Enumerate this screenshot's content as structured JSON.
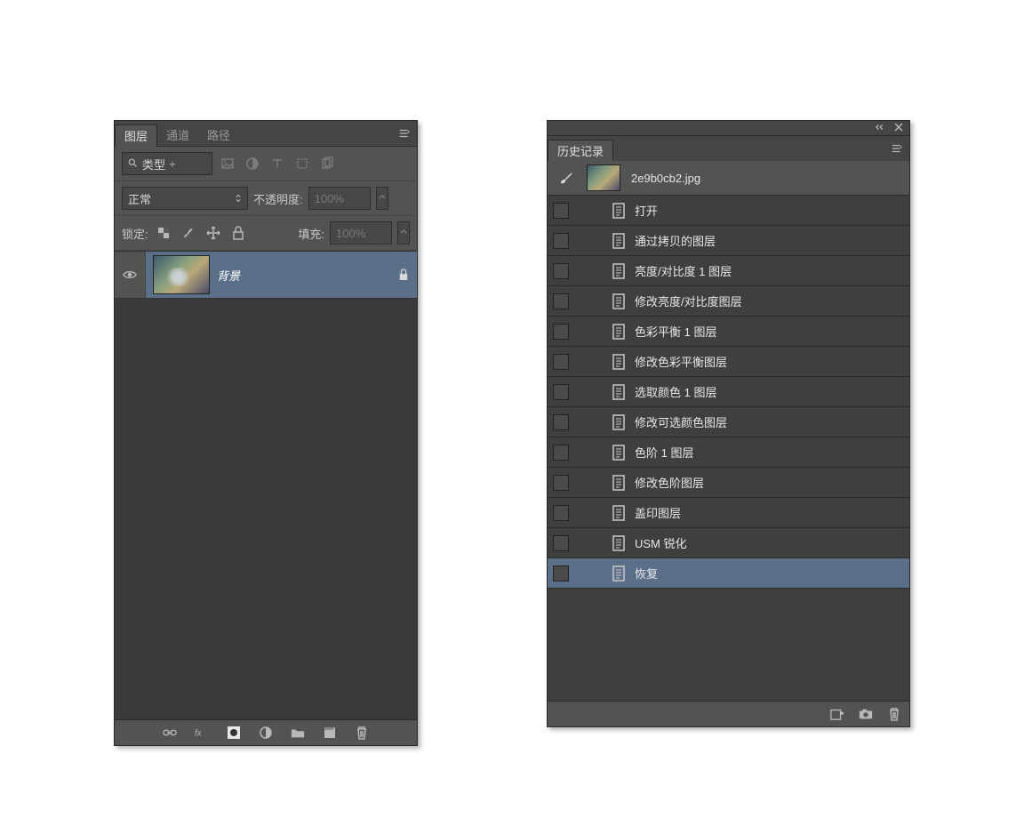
{
  "layers_panel": {
    "tabs": [
      "图层",
      "通道",
      "路径"
    ],
    "active_tab_index": 0,
    "filter": {
      "label": "类型"
    },
    "blend_mode": "正常",
    "opacity_label": "不透明度:",
    "opacity_value": "100%",
    "lock_label": "锁定:",
    "fill_label": "填充:",
    "fill_value": "100%",
    "layer": {
      "name": "背景"
    }
  },
  "history_panel": {
    "tab": "历史记录",
    "filename": "2e9b0cb2.jpg",
    "items": [
      "打开",
      "通过拷贝的图层",
      "亮度/对比度 1 图层",
      "修改亮度/对比度图层",
      "色彩平衡 1 图层",
      "修改色彩平衡图层",
      "选取颜色 1 图层",
      "修改可选颜色图层",
      "色阶 1 图层",
      "修改色阶图层",
      "盖印图层",
      "USM 锐化",
      "恢复"
    ],
    "selected_index": 12
  }
}
